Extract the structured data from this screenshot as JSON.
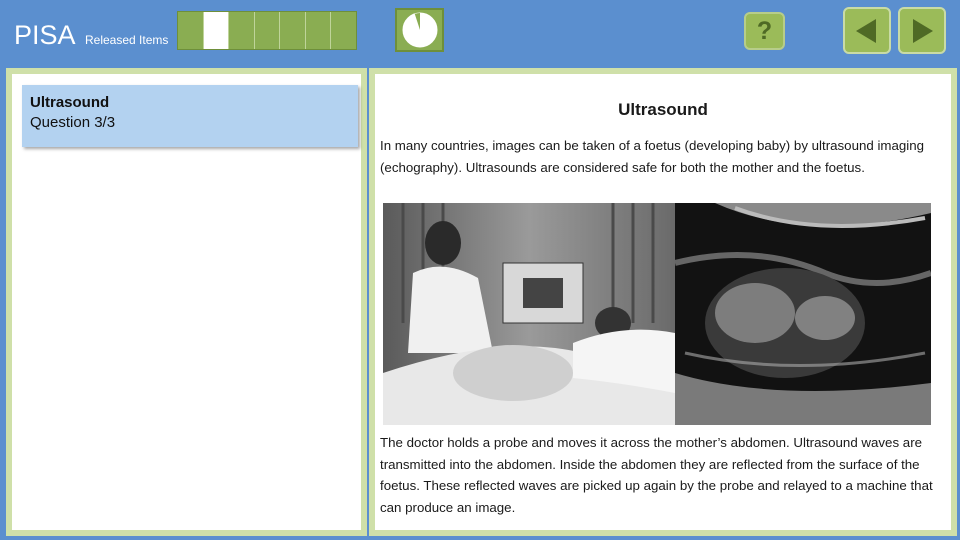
{
  "header": {
    "title": "PISA",
    "subtitle": "Released Items",
    "progress_total": 7,
    "progress_active_index": 1,
    "timer_fill_fraction": 0.95,
    "help_label": "?",
    "prev_icon": "triangle-left-icon",
    "next_icon": "triangle-right-icon"
  },
  "sidebar": {
    "items": [
      {
        "title": "Ultrasound",
        "subtitle": "Question 3/3"
      }
    ]
  },
  "stimulus": {
    "title": "Ultrasound",
    "paragraph1": "In many countries, images can be taken of a foetus (developing baby) by ultrasound imaging (echography). Ultrasounds are considered safe for both the mother and the foetus.",
    "paragraph2": "The doctor holds a probe and moves it across the mother’s abdomen. Ultrasound waves are transmitted into the abdomen. Inside the abdomen they are reflected from the surface of the foetus. These reflected waves are picked up again by the probe and relayed to a machine that can produce an image."
  },
  "colors": {
    "background": "#5b8fcf",
    "panel_border": "#cfe0a9",
    "button_green": "#9bbb59",
    "selected_item": "#b3d2f0"
  }
}
